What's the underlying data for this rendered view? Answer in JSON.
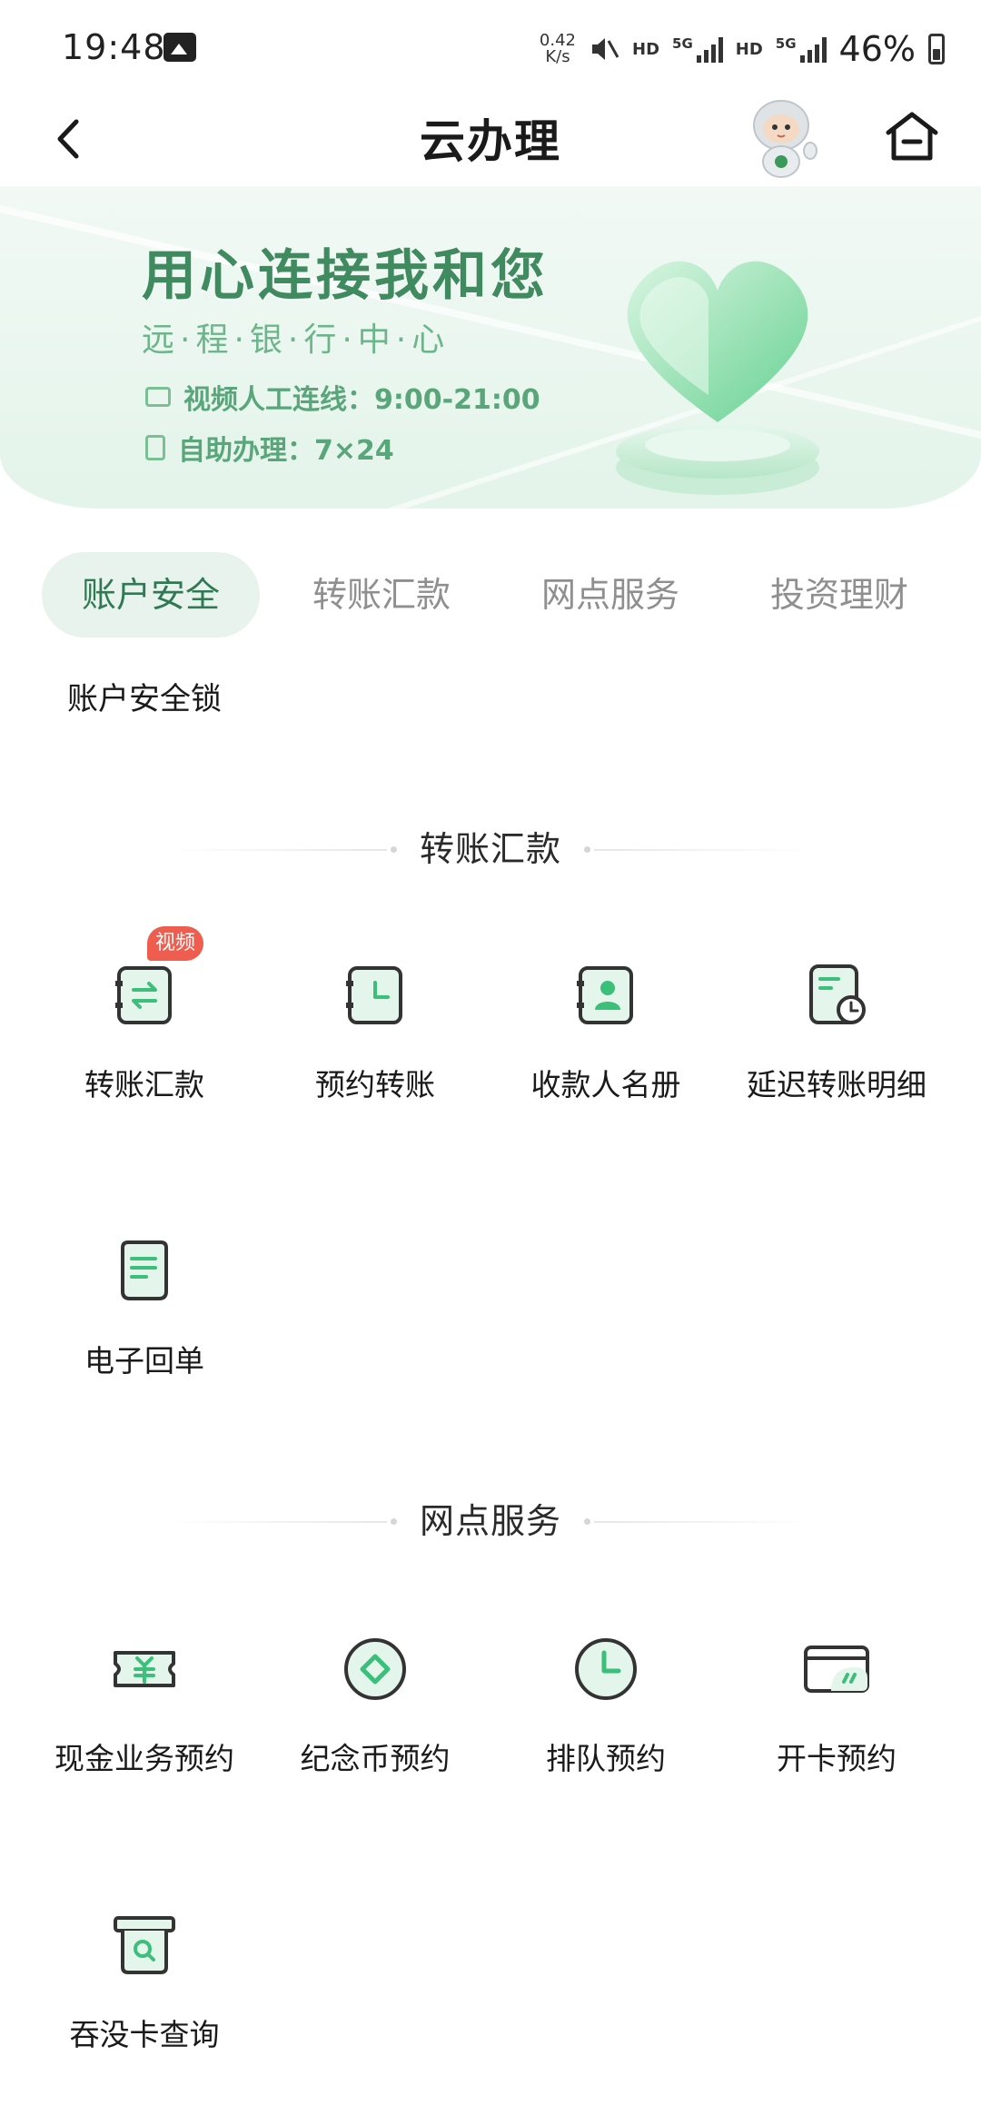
{
  "status_bar": {
    "time": "19:48",
    "net_speed_value": "0.42",
    "net_speed_unit": "K/s",
    "hd1": "HD",
    "net1": "5G",
    "hd2": "HD",
    "net2": "5G",
    "battery": "46%"
  },
  "header": {
    "title": "云办理"
  },
  "banner": {
    "title": "用心连接我和您",
    "subtitle": "远·程·银·行·中·心",
    "video_line": "视频人工连线：9:00-21:00",
    "self_line": "自助办理：7×24"
  },
  "tabs": [
    {
      "label": "账户安全",
      "active": true
    },
    {
      "label": "转账汇款",
      "active": false
    },
    {
      "label": "网点服务",
      "active": false
    },
    {
      "label": "投资理财",
      "active": false
    }
  ],
  "account_security": {
    "items": [
      {
        "label": "账户安全锁"
      }
    ]
  },
  "transfer": {
    "heading": "转账汇款",
    "badge": "视频",
    "items": [
      {
        "label": "转账汇款",
        "icon": "transfer-icon"
      },
      {
        "label": "预约转账",
        "icon": "scheduled-transfer-icon"
      },
      {
        "label": "收款人名册",
        "icon": "payee-book-icon"
      },
      {
        "label": "延迟转账明细",
        "icon": "delayed-transfer-icon"
      },
      {
        "label": "电子回单",
        "icon": "e-receipt-icon"
      }
    ]
  },
  "branch": {
    "heading": "网点服务",
    "items": [
      {
        "label": "现金业务预约",
        "icon": "cash-ticket-icon"
      },
      {
        "label": "纪念币预约",
        "icon": "coin-icon"
      },
      {
        "label": "排队预约",
        "icon": "clock-icon"
      },
      {
        "label": "开卡预约",
        "icon": "card-icon"
      },
      {
        "label": "吞没卡查询",
        "icon": "card-search-icon"
      }
    ]
  },
  "colors": {
    "accent": "#2f7a52",
    "icon_green": "#3bbf7a",
    "badge_red": "#ef5d4f"
  }
}
